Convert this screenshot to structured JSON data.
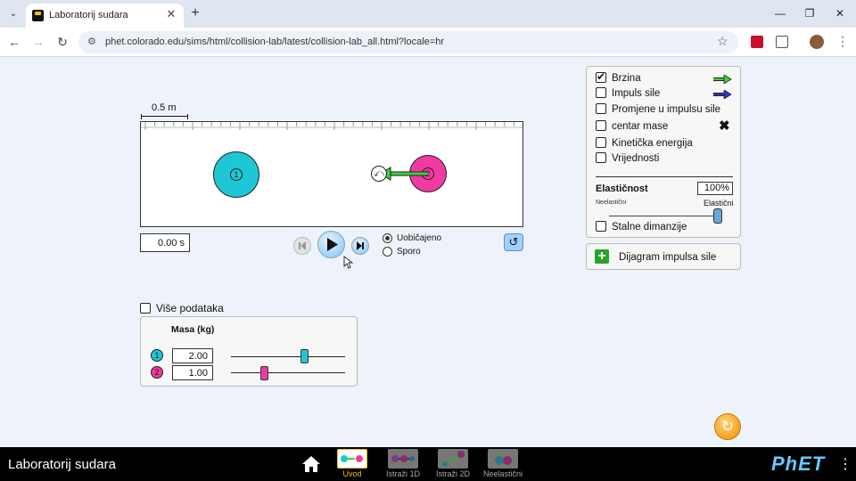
{
  "browser": {
    "tab_title": "Laboratorij sudara",
    "url": "phet.colorado.edu/sims/html/collision-lab/latest/collision-lab_all.html?locale=hr"
  },
  "sim": {
    "scale_label": "0.5 m",
    "time": "0.00 s",
    "speed_options": [
      "Uobičajeno",
      "Sporo"
    ],
    "selected_speed": "Uobičajeno",
    "balls": [
      {
        "label": "1",
        "color": "#1ec7d6"
      },
      {
        "label": "2",
        "color": "#f03aa0"
      }
    ]
  },
  "controls": {
    "checkboxes": [
      {
        "label": "Brzina",
        "checked": true,
        "icon": "green-arrow-icon"
      },
      {
        "label": "Impuls sile",
        "checked": false,
        "icon": "blue-arrow-icon"
      },
      {
        "label": "Promjene u impulsu sile",
        "checked": false
      },
      {
        "label": "centar mase",
        "checked": false,
        "icon": "x-mark-icon"
      },
      {
        "label": "Kinetička energija",
        "checked": false
      },
      {
        "label": "Vrijednosti",
        "checked": false
      }
    ],
    "elasticity_label": "Elastičnost",
    "elasticity_value": "100%",
    "elasticity_level": 1.0,
    "elasticity_min_label": "Neelastični",
    "elasticity_max_label": "Elastični",
    "constant_size_label": "Stalne dimanzije",
    "constant_size_checked": false,
    "impulse_diagram_label": "Dijagram impulsa sile"
  },
  "mass": {
    "more_data_label": "Više podataka",
    "title": "Masa (kg)",
    "balls": [
      {
        "label": "1",
        "value": "2.00",
        "level": 0.65,
        "color": "#1ec7d6"
      },
      {
        "label": "2",
        "value": "1.00",
        "level": 0.3,
        "color": "#f03aa0"
      }
    ]
  },
  "navbar": {
    "title": "Laboratorij sudara",
    "screens": [
      "Uvod",
      "Istraži 1D",
      "Istraži 2D",
      "Neelastični"
    ],
    "active_screen": "Uvod",
    "logo": "PhET"
  }
}
